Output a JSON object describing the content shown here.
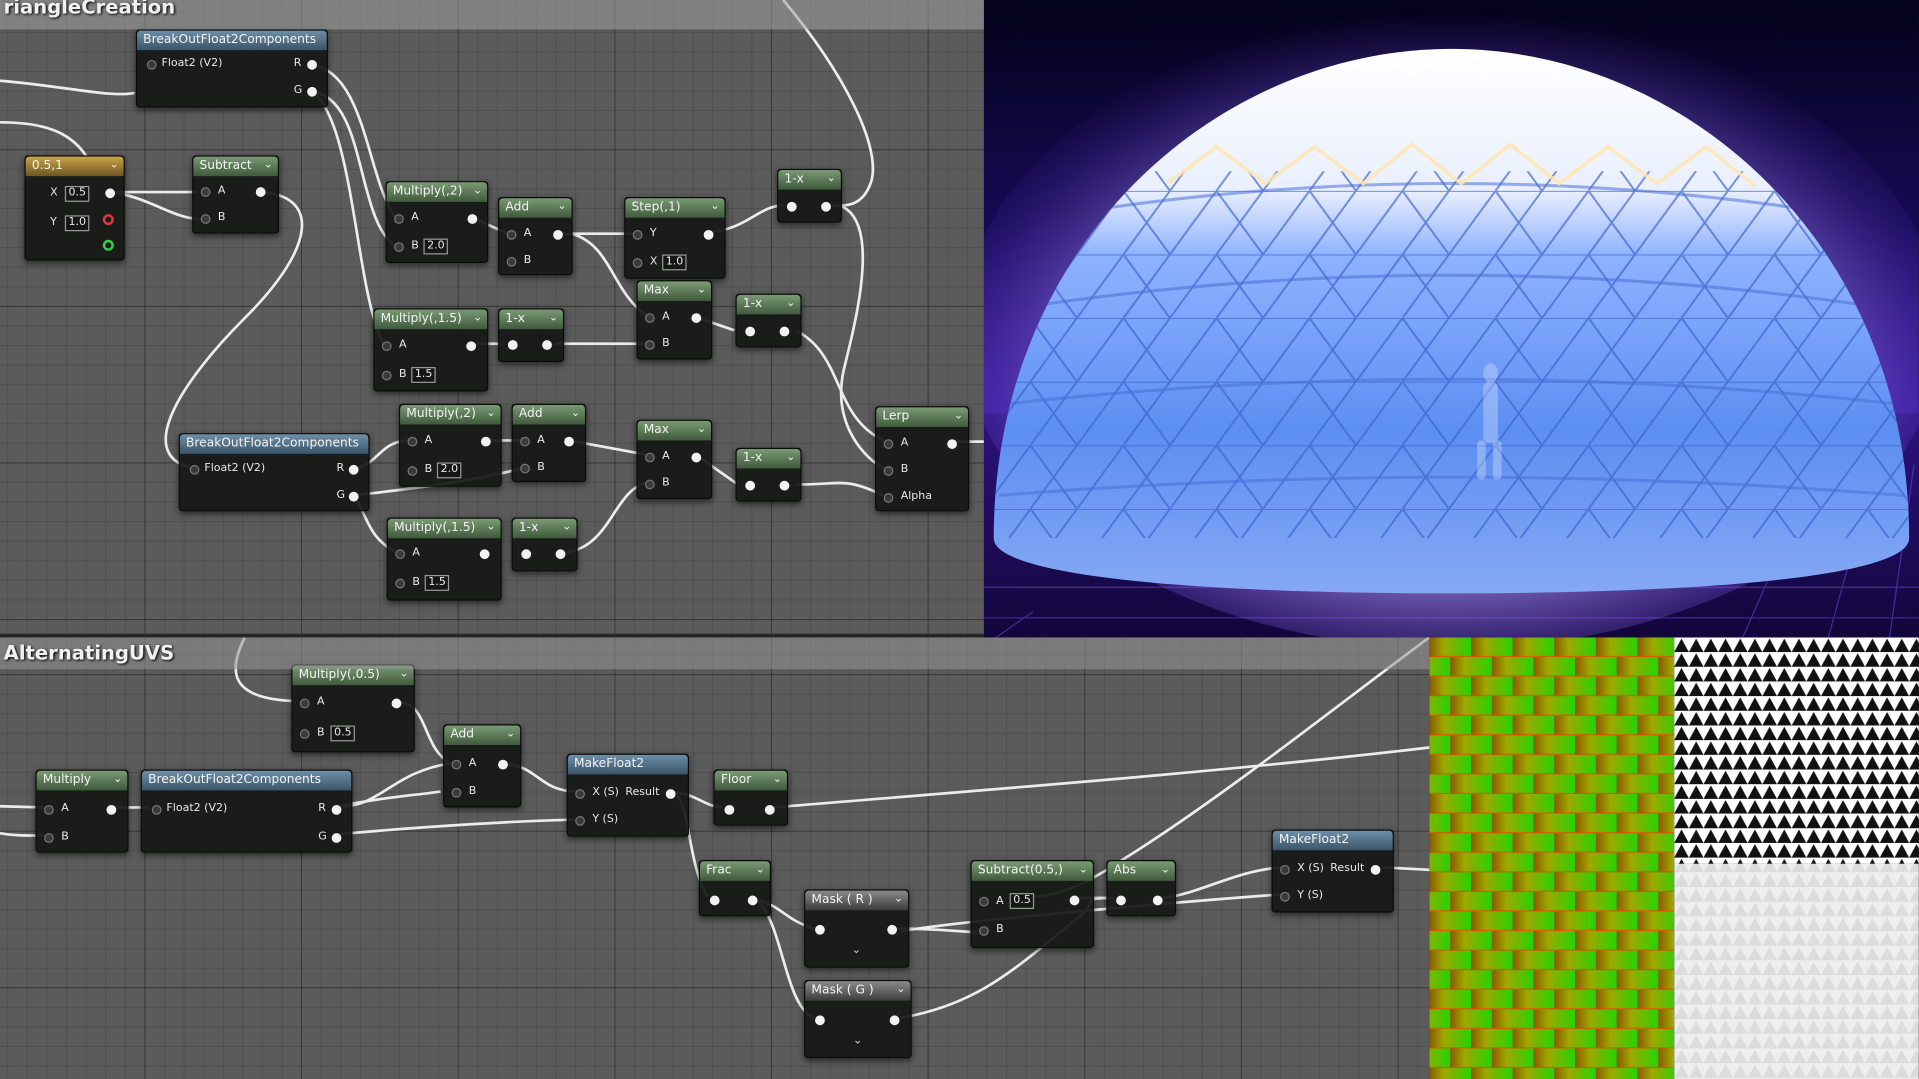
{
  "graphs": {
    "top_title": "riangleCreation",
    "bottom_title": "AlternatingUVS"
  },
  "nodes": {
    "breakout_top": {
      "title": "BreakOutFloat2Components",
      "in": "Float2 (V2)",
      "out_r": "R",
      "out_g": "G"
    },
    "constant": {
      "title": "0.5,1",
      "x_label": "X",
      "x_value": "0.5",
      "y_label": "Y",
      "y_value": "1.0"
    },
    "subtract_top": {
      "title": "Subtract",
      "a": "A",
      "b": "B"
    },
    "multiply2_top": {
      "title": "Multiply(,2)",
      "a": "A",
      "b": "B",
      "b_value": "2.0"
    },
    "add_top": {
      "title": "Add",
      "a": "A",
      "b": "B"
    },
    "step": {
      "title": "Step(,1)",
      "y": "Y",
      "x": "X",
      "x_value": "1.0"
    },
    "oneminus_a": {
      "title": "1-x"
    },
    "max_top": {
      "title": "Max",
      "a": "A",
      "b": "B"
    },
    "oneminus_b": {
      "title": "1-x"
    },
    "multiply15_top": {
      "title": "Multiply(,1.5)",
      "a": "A",
      "b": "B",
      "b_value": "1.5"
    },
    "oneminus_c": {
      "title": "1-x"
    },
    "breakout_mid": {
      "title": "BreakOutFloat2Components",
      "in": "Float2 (V2)",
      "out_r": "R",
      "out_g": "G"
    },
    "multiply2_mid": {
      "title": "Multiply(,2)",
      "a": "A",
      "b": "B",
      "b_value": "2.0"
    },
    "add_mid": {
      "title": "Add",
      "a": "A",
      "b": "B"
    },
    "max_mid": {
      "title": "Max",
      "a": "A",
      "b": "B"
    },
    "oneminus_d": {
      "title": "1-x"
    },
    "multiply15_mid": {
      "title": "Multiply(,1.5)",
      "a": "A",
      "b": "B",
      "b_value": "1.5"
    },
    "oneminus_e": {
      "title": "1-x"
    },
    "lerp": {
      "title": "Lerp",
      "a": "A",
      "b": "B",
      "alpha": "Alpha"
    },
    "multiply05": {
      "title": "Multiply(,0.5)",
      "a": "A",
      "b": "B",
      "b_value": "0.5"
    },
    "add_bottom": {
      "title": "Add",
      "a": "A",
      "b": "B"
    },
    "multiply_bottom": {
      "title": "Multiply",
      "a": "A",
      "b": "B"
    },
    "breakout_bottom": {
      "title": "BreakOutFloat2Components",
      "in": "Float2 (V2)",
      "out_r": "R",
      "out_g": "G"
    },
    "makefloat2_a": {
      "title": "MakeFloat2",
      "x": "X (S)",
      "y": "Y (S)",
      "result": "Result"
    },
    "floor": {
      "title": "Floor"
    },
    "frac": {
      "title": "Frac"
    },
    "mask_r": {
      "title": "Mask ( R )"
    },
    "mask_g": {
      "title": "Mask ( G )"
    },
    "subtract05": {
      "title": "Subtract(0.5,)",
      "a": "A",
      "a_value": "0.5",
      "b": "B"
    },
    "abs": {
      "title": "Abs"
    },
    "makefloat2_b": {
      "title": "MakeFloat2",
      "x": "X (S)",
      "y": "Y (S)",
      "result": "Result"
    }
  },
  "colors": {
    "graph_bg": "#5b5b5b",
    "node_body": "#161816",
    "header_green": "#4e6b4a",
    "header_blue": "#4a657a",
    "header_gold": "#b08d35",
    "wire": "#ececec",
    "dome_blue": "#4f7fe8",
    "sky": "#1a0c5e"
  },
  "icons": [
    "chevron-down-icon",
    "pin-icon"
  ]
}
